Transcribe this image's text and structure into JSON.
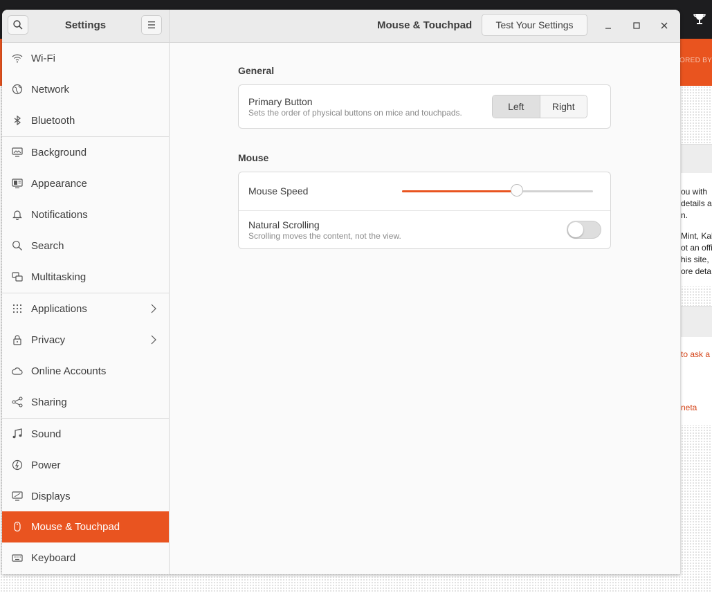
{
  "background_page": {
    "sponsor_text": "ORED BY",
    "text_lines": [
      "ou with",
      " details a",
      "n.",
      "",
      "Mint, Kal",
      "ot an offi",
      "his site,",
      "ore deta"
    ],
    "link_1": " to ask a",
    "link_2": "neta"
  },
  "window": {
    "sidebar_title": "Settings",
    "page_title": "Mouse & Touchpad",
    "test_button_label": "Test Your Settings"
  },
  "sidebar": {
    "items": [
      {
        "label": "Wi-Fi",
        "icon": "wifi-icon"
      },
      {
        "label": "Network",
        "icon": "globe-icon"
      },
      {
        "label": "Bluetooth",
        "icon": "bluetooth-icon"
      },
      {
        "label": "Background",
        "icon": "monitor-image-icon"
      },
      {
        "label": "Appearance",
        "icon": "appearance-icon"
      },
      {
        "label": "Notifications",
        "icon": "bell-icon"
      },
      {
        "label": "Search",
        "icon": "search-icon"
      },
      {
        "label": "Multitasking",
        "icon": "windows-icon"
      },
      {
        "label": "Applications",
        "icon": "grid-icon"
      },
      {
        "label": "Privacy",
        "icon": "lock-icon"
      },
      {
        "label": "Online Accounts",
        "icon": "cloud-icon"
      },
      {
        "label": "Sharing",
        "icon": "share-icon"
      },
      {
        "label": "Sound",
        "icon": "music-note-icon"
      },
      {
        "label": "Power",
        "icon": "power-icon"
      },
      {
        "label": "Displays",
        "icon": "display-icon"
      },
      {
        "label": "Mouse & Touchpad",
        "icon": "mouse-icon"
      },
      {
        "label": "Keyboard",
        "icon": "keyboard-icon"
      }
    ],
    "active_item": "Mouse & Touchpad"
  },
  "content": {
    "general": {
      "heading": "General",
      "primary_button_title": "Primary Button",
      "primary_button_subtitle": "Sets the order of physical buttons on mice and touchpads.",
      "options": [
        "Left",
        "Right"
      ],
      "selected": "Left"
    },
    "mouse": {
      "heading": "Mouse",
      "speed_label": "Mouse Speed",
      "speed_value_fraction": 0.6,
      "natural_scrolling_title": "Natural Scrolling",
      "natural_scrolling_subtitle": "Scrolling moves the content, not the view.",
      "natural_scrolling_enabled": false
    }
  },
  "colors": {
    "accent": "#e95420",
    "header_bg": "#ebebeb",
    "window_bg": "#fafafa"
  }
}
